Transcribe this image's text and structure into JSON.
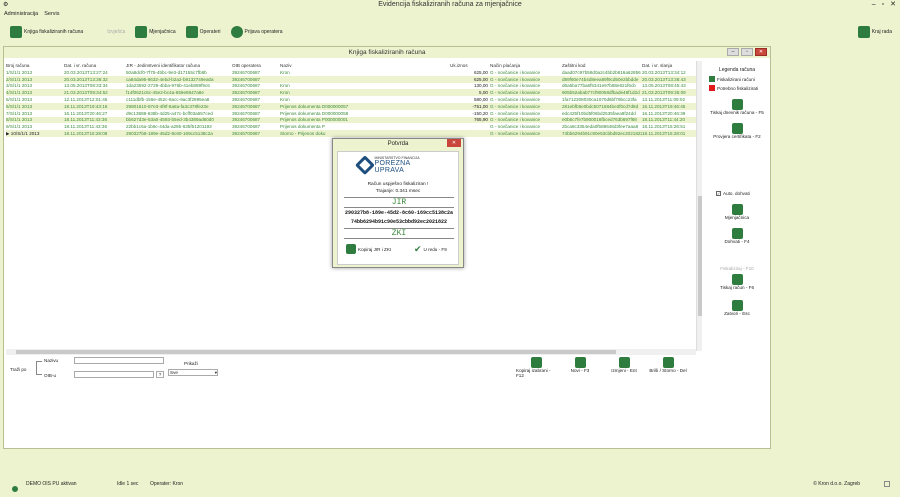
{
  "app": {
    "title": "Evidencija fiskaliziranih računa za mjenjačnice"
  },
  "menu": [
    "Administracija",
    "Servis"
  ],
  "toolbar": {
    "fiscal_book": "Knjiga fiskaliziranih računa",
    "izvjesca": "Izvješća",
    "mjenjacnica": "Mjenjačnica",
    "operateri": "Operateri",
    "prijava": "Prijava operatera",
    "kraj": "Kraj rada"
  },
  "inner": {
    "title": "Knjiga fiskaliziranih računa"
  },
  "columns": [
    "Broj računa",
    "Dat. i vr. računa",
    "JIR - Jedinstveni identifikator računa",
    "OIB operatera",
    "Naziv",
    "Uk.iznos",
    "Način plaćanja",
    "Zaštitni kod",
    "Dat. i vr. slanja"
  ],
  "rows": [
    [
      "1/S/1/1 2013",
      "20.03.2013T13:27:24",
      "50a8dcf0-7f75-4bbc-9e3-d17155c7fb8b",
      "39246700687",
      "Kron",
      "625,00",
      "G - novčanice i kovanice",
      "daad07c97b58d0a2c4bb2b816a62856",
      "20.03.2013T13:34:12"
    ],
    [
      "2/S/1/1 2013",
      "20.03.2013T13:36:32",
      "ca84da95-6632-4ebd-b2a2-b9132749ea0a",
      "39246700687",
      "",
      "625,00",
      "G - novčanice i kovanice",
      "d89f60e74b4d8eea89f9cd50e2bbdde",
      "20.03.2013T13:36:43"
    ],
    [
      "3/S/1/1 2013",
      "13.05.2013T08:33:34",
      "1da23592-2729-4bba-976b-41eb889f9c6",
      "39246700687",
      "Kron",
      "130,00",
      "G - novčanice i kovanice",
      "d6a5ba77ba6f5341e97b88e821f6cb",
      "13.05.2013T08:45:43"
    ],
    [
      "4/S/1/1 2013",
      "21.03.2013T09:34:52",
      "f14f0621c6c-45e2-bc4a-659e8647a8e",
      "39246700687",
      "Kron",
      "5,00",
      "G - novčanice i kovanice",
      "905b52abab77cf90058dfbade48f1d2d",
      "21.03.2013T09:35:09"
    ],
    [
      "5/S/1/1 2013",
      "12.11.2013T12:01:45",
      "c111dbfb-156e-452c-8acc-9ac3f2895ea8",
      "39246700687",
      "Kron",
      "580,00",
      "G - novčanice i kovanice",
      "1fa712308030ca1070d6bf79bcc23fa",
      "13.11.2013T11:09:02"
    ],
    [
      "6/S/1/1 2013",
      "18.11.2013T19:43:16",
      "29801610-87e3-4f8f-8a8a-fa3c378fe23e",
      "39246700687",
      "Prijenos dokumenta D000000057",
      "-751,00",
      "G - novčanice i kovanice",
      "281ebfb5e0bdc5071684be3f0cd7d8d",
      "16.11.2013T19:46:45"
    ],
    [
      "7/S/1/1 2013",
      "16.11.2013T20:46:27",
      "d9c13888-638b-4d25-a47c-bcff03a657ced",
      "39246700687",
      "Prijenos dokumenta D000000058",
      "-150,20",
      "G - novčanice i kovanice",
      "edc425f10bd5f06bd2535faea8f24dd",
      "16.11.2013T20:46:39"
    ],
    [
      "8/S/1/1 2013",
      "18.11.2013T11:43:36",
      "bb627d3e-53a0-4593-b5ed-3b4389ad60d0",
      "39246700687",
      "Prijenos dokumenta P000000001",
      "765,90",
      "G - novčanice i kovanice",
      "e0b6c7fe7b900016fbced763b697f68",
      "18.11.2013T11:44:20"
    ],
    [
      "9/S/1/1 2013",
      "18.11.2013T11:43:36",
      "22bb1c6a-1b6c-44da-a29b-635f51201193",
      "39246700687",
      "Prijenos dokumenta P",
      "",
      "G - novčanice i kovanice",
      "2bca8c3354eda0f588648d3fee7aaa8",
      "18.11.2013T15:26:51"
    ],
    [
      "10/S/1/1 2013",
      "18.11.2013T15:28:08",
      "290327b8-189e-45d2-8c60-169cc5138c2a",
      "39246700687",
      "Storno - Prijenos doku",
      "",
      "G - novčanice i kovanice",
      "74bb6294b91c90e53cbbd92ec2021822",
      "18.11.2013T15:28:01"
    ]
  ],
  "legend": {
    "title": "Legenda računa",
    "fiscal": "Fiskalizirani računi",
    "needed": "Potrebno fiskalizirati",
    "green": "#2f7d3e",
    "red": "#e01b1b"
  },
  "right": {
    "print": "Tiskaj dnevnik računa - F5",
    "cert": "Provjera certifikata - F2",
    "auto": "Auto. dohvati",
    "mjenj": "Mjenjačnica",
    "dohvati": "Dohvati - F4",
    "fisk": "Fiskaliziraj - F10",
    "tiskaj": "Tiskaj račun - F6",
    "zatvori": "Zatvori - Esc"
  },
  "filter": {
    "trazi": "Traži po",
    "naziv": "Nazivu",
    "oib": "OIB-u",
    "prikazi": "Prikaži",
    "sve": "Sve",
    "q": "?"
  },
  "bottom": {
    "kopiraj": "Kopiraj izabrani - F12",
    "novi": "Novi - F3",
    "izmjeni": "Izmjeni - Ent",
    "brisi": "Briši / Storno - Del"
  },
  "dialog": {
    "title": "Potvrda",
    "ministry": "MINISTARSTVO FINANCIJA",
    "porezna": "POREZNA UPRAVA",
    "msg": "Račun uspješno fiskaliziran !",
    "time": "Trajanje: 0.341 msec",
    "jir_lbl": "JIR",
    "jir1": "290327b8-189e-45d2-8c60-169cc5138c2a",
    "jir2": "74bb6294b91c90e53cbbd92ec2021822",
    "zki_lbl": "ZKI",
    "copy": "Kopiraj JIR i ZKI",
    "ok": "U redu - F9"
  },
  "status": {
    "demo": "DEMO OIS PU aktivan",
    "idle": "Idle 1 sec",
    "operator": "Operater: Kron",
    "copyright": "© Kron d.o.o. Zagreb"
  }
}
